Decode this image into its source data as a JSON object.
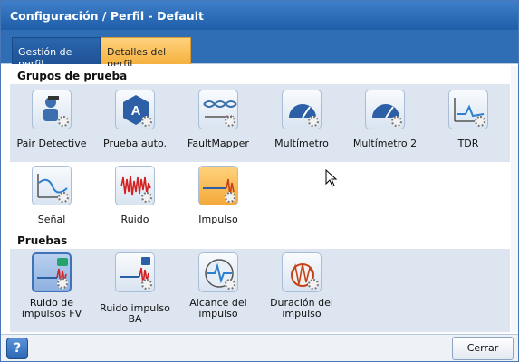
{
  "window": {
    "title": "Configuración / Perfil - Default"
  },
  "tabs": [
    {
      "label": "Gestión de perfil"
    },
    {
      "label": "Detalles del perfil"
    }
  ],
  "groups_section": {
    "title": "Grupos de prueba"
  },
  "groups": [
    {
      "label": "Pair Detective",
      "icon": "pair-detective-icon"
    },
    {
      "label": "Prueba auto.",
      "icon": "auto-test-icon"
    },
    {
      "label": "FaultMapper",
      "icon": "faultmapper-icon"
    },
    {
      "label": "Multímetro",
      "icon": "multimeter-icon"
    },
    {
      "label": "Multímetro 2",
      "icon": "multimeter-2-icon"
    },
    {
      "label": "TDR",
      "icon": "tdr-icon"
    },
    {
      "label": "Señal",
      "icon": "signal-icon"
    },
    {
      "label": "Ruido",
      "icon": "noise-icon"
    },
    {
      "label": "Impulso",
      "icon": "impulse-icon"
    }
  ],
  "tests_section": {
    "title": "Pruebas"
  },
  "tests": [
    {
      "label": "Ruido de impulsos FV",
      "icon": "vf-impulse-noise-icon"
    },
    {
      "label": "Ruido impulso BA",
      "icon": "wb-impulse-noise-icon"
    },
    {
      "label": "Alcance del impulso",
      "icon": "impulse-reach-icon"
    },
    {
      "label": "Duración del impulso",
      "icon": "impulse-duration-icon"
    }
  ],
  "footer": {
    "help": "?",
    "close": "Cerrar"
  },
  "colors": {
    "title_bar": "#1f5ea8",
    "active_tab": "#f5b13e",
    "band": "#dde5f0"
  }
}
